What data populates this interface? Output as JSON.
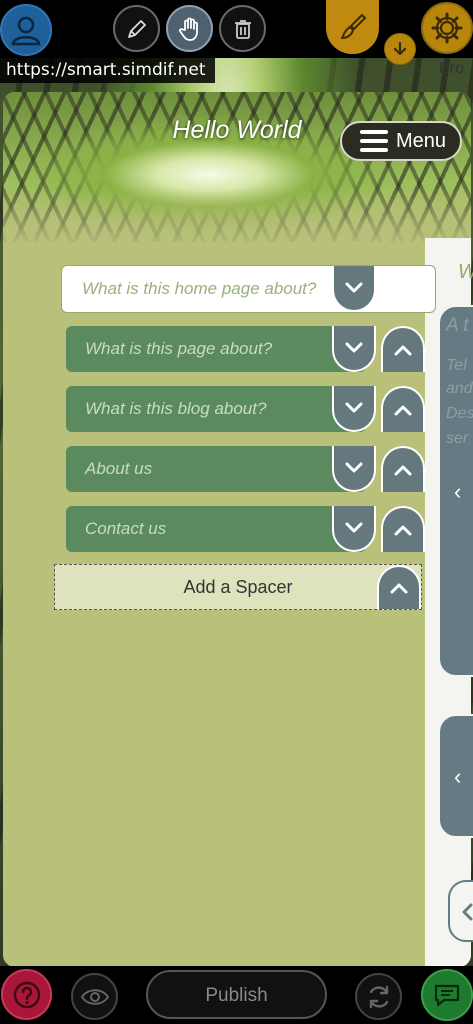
{
  "browser": {
    "url": "https://smart.simdif.net"
  },
  "top_toolbar": {
    "avatar_icon": "user-avatar-icon",
    "edit_icon": "pencil-icon",
    "move_icon": "hand-icon",
    "delete_icon": "trash-icon",
    "design_icon": "paintbrush-icon",
    "download_icon": "download-icon",
    "settings_icon": "gear-icon",
    "pro_label": "Pro",
    "colors": {
      "design": "#c08a10",
      "settings": "#b8860b",
      "avatar": "#1f5f9a"
    }
  },
  "site": {
    "title": "Hello World",
    "menu_label": "Menu"
  },
  "pages": {
    "home_placeholder": "What is this home page about?",
    "items": [
      {
        "label": "What is this page about?"
      },
      {
        "label": "What is this blog about?"
      },
      {
        "label": "About us"
      },
      {
        "label": "Contact us"
      }
    ],
    "spacer_label": "Add a Spacer"
  },
  "right_panel": {
    "heading_fragment": "W",
    "text_lines": [
      "A t",
      "Tel",
      "and",
      "Des",
      "ser"
    ]
  },
  "bottom_toolbar": {
    "help_icon": "question-icon",
    "preview_icon": "eye-icon",
    "publish_label": "Publish",
    "sync_icon": "refresh-icon",
    "chat_icon": "chat-icon",
    "colors": {
      "help": "#a8163a",
      "chat": "#1e7a2e",
      "page_row": "#5b8a5f",
      "background": "#b8c07a"
    }
  }
}
